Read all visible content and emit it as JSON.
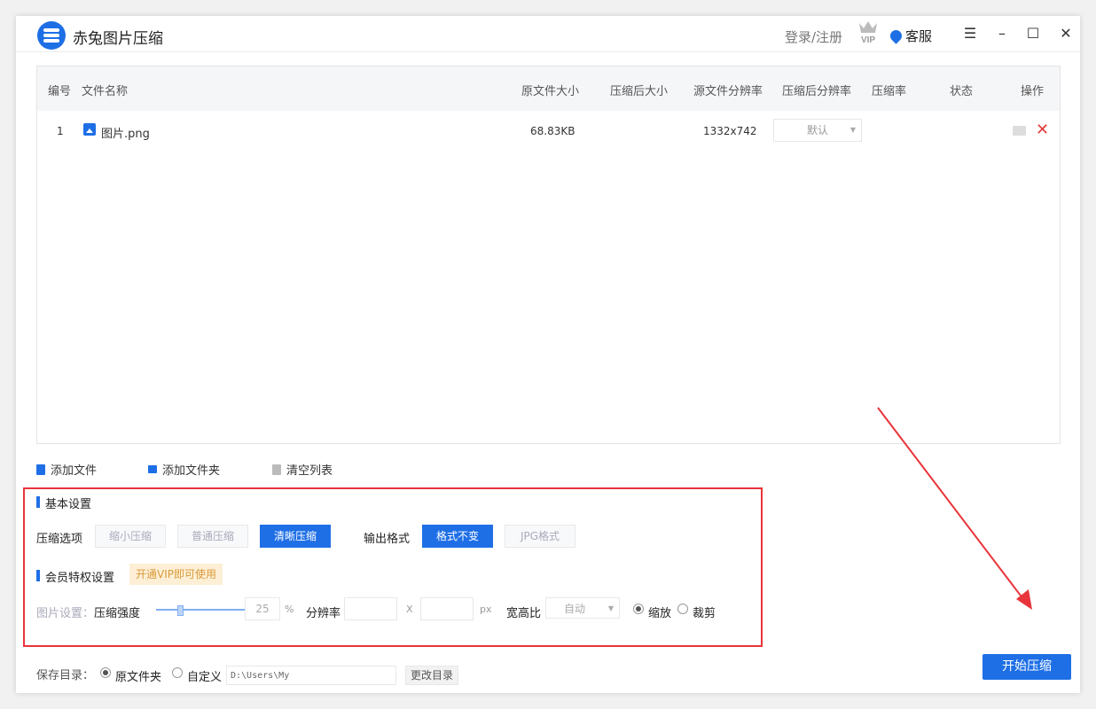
{
  "app": {
    "title": "赤兔图片压缩"
  },
  "header": {
    "login": "登录/注册",
    "vip_icon": "crown-vip-icon",
    "vip_text": "VIP",
    "service": "客服"
  },
  "window_controls": {
    "menu": "☰",
    "minimize": "–",
    "maximize": "☐",
    "close": "✕"
  },
  "table": {
    "columns": [
      "编号",
      "文件名称",
      "原文件大小",
      "压缩后大小",
      "源文件分辨率",
      "压缩后分辨率",
      "压缩率",
      "状态",
      "操作"
    ],
    "rows": [
      {
        "index": "1",
        "name": "图片.png",
        "size": "68.83KB",
        "compressed_size": "",
        "resolution": "1332x742",
        "out_resolution": "默认",
        "ratio": "",
        "status": ""
      }
    ]
  },
  "toolbar": {
    "add_file": "添加文件",
    "add_folder": "添加文件夹",
    "clear": "清空列表"
  },
  "basic": {
    "title": "基本设置",
    "compress_label": "压缩选项",
    "options": [
      "缩小压缩",
      "普通压缩",
      "清晰压缩"
    ],
    "selected_option": "清晰压缩",
    "format_label": "输出格式",
    "formats": [
      "格式不变",
      "JPG格式"
    ],
    "selected_format": "格式不变"
  },
  "vip": {
    "title": "会员特权设置",
    "badge": "开通VIP即可使用",
    "image_settings": "图片设置：",
    "strength_label": "压缩强度",
    "strength_value": "25",
    "percent": "%",
    "resolution_label": "分辨率",
    "x": "X",
    "px": "px",
    "aspect_label": "宽高比",
    "aspect_value": "自动",
    "scale": "缩放",
    "crop": "裁剪",
    "scale_selected": true
  },
  "save": {
    "label": "保存目录：",
    "original": "原文件夹",
    "custom": "自定义",
    "path": "D:\\Users\\My Documents\\CTImageCo",
    "change": "更改目录"
  },
  "start": "开始压缩",
  "colors": {
    "accent": "#1e6fe6",
    "annotation": "#e8343a",
    "delete": "#e23c3c"
  }
}
